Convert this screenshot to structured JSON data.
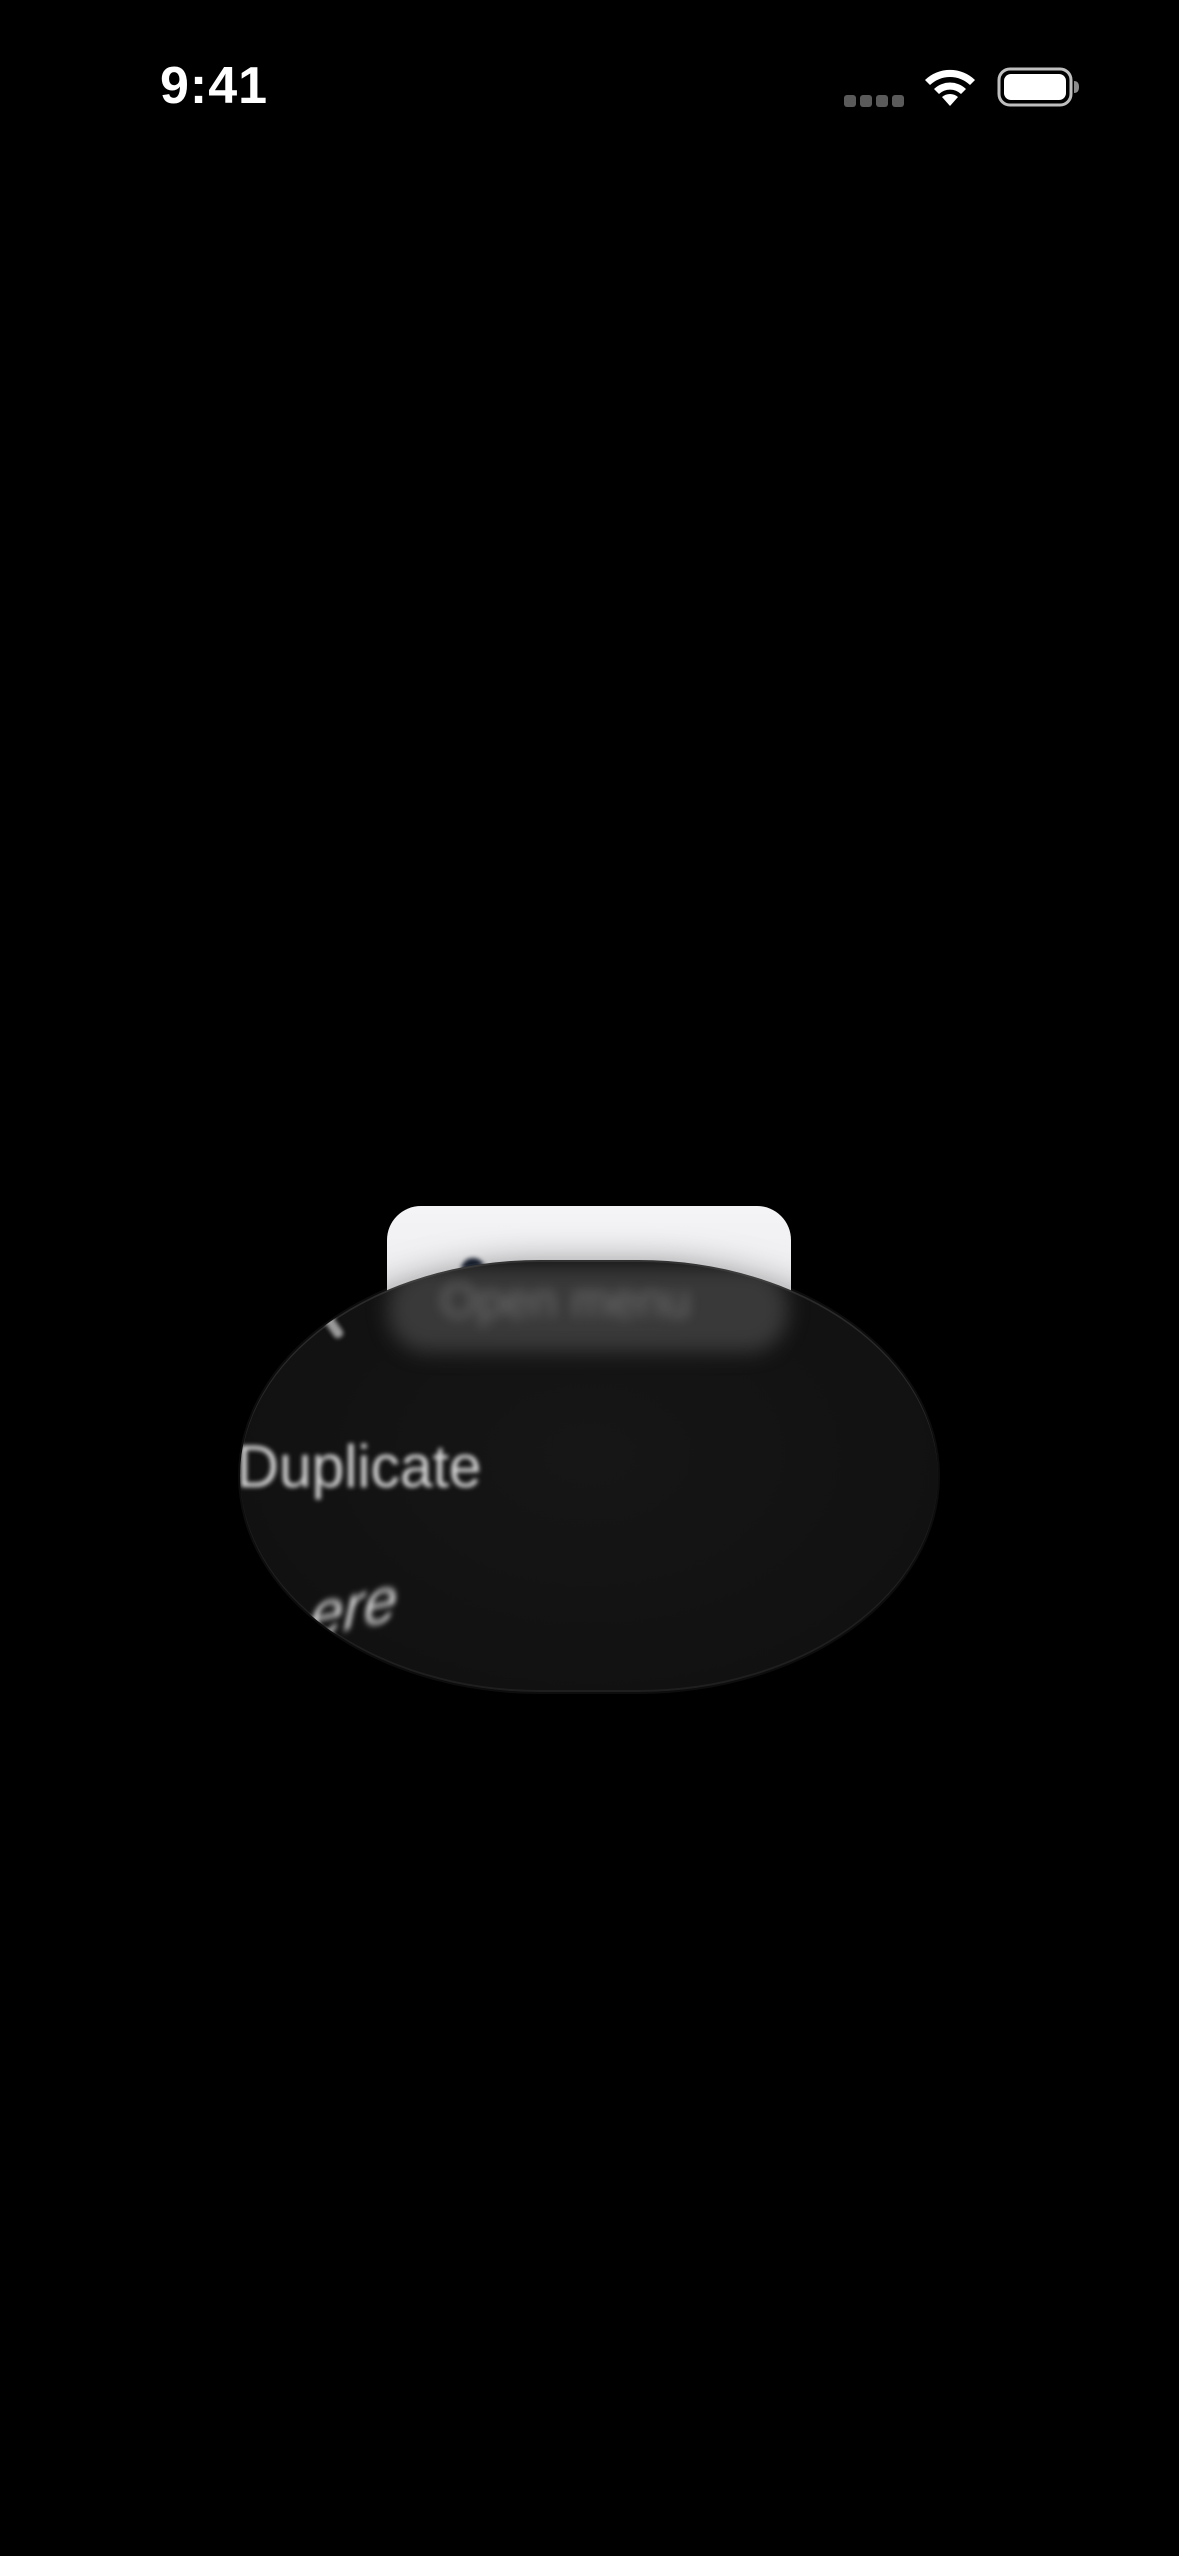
{
  "status_bar": {
    "time": "9:41",
    "signal_icon": "cellular-signal-icon",
    "wifi_icon": "wifi-icon",
    "battery_icon": "battery-icon"
  },
  "context_menu": {
    "items": [
      {
        "label": "Open menu",
        "state": "blurred"
      },
      {
        "label": "Duplicate",
        "state": "distorted"
      },
      {
        "label": "ere",
        "state": "distorted"
      }
    ]
  },
  "colors": {
    "background": "#000000",
    "menu_surface": "#141414",
    "preview_card": "#f0f0f2",
    "menu_text": "#d6d6d6"
  }
}
